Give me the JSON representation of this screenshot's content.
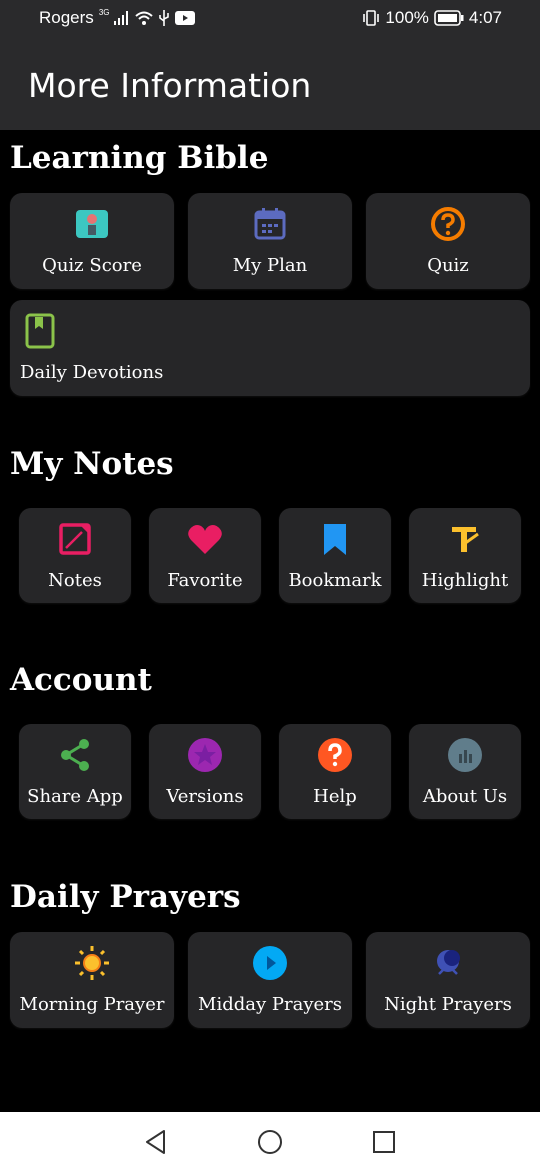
{
  "status": {
    "carrier": "Rogers",
    "network": "3G",
    "battery": "100%",
    "time": "4:07"
  },
  "appbar": {
    "title": "More Information"
  },
  "sections": {
    "learning": {
      "title": "Learning Bible",
      "items": [
        {
          "label": "Quiz Score",
          "icon": "quiz-score-icon"
        },
        {
          "label": "My Plan",
          "icon": "calendar-icon"
        },
        {
          "label": "Quiz",
          "icon": "question-circle-icon"
        },
        {
          "label": "Daily Devotions",
          "icon": "book-icon"
        }
      ]
    },
    "notes": {
      "title": "My Notes",
      "items": [
        {
          "label": "Notes",
          "icon": "note-icon"
        },
        {
          "label": "Favorite",
          "icon": "heart-icon"
        },
        {
          "label": "Bookmark",
          "icon": "bookmark-icon"
        },
        {
          "label": "Highlight",
          "icon": "highlight-icon"
        }
      ]
    },
    "account": {
      "title": "Account",
      "items": [
        {
          "label": "Share App",
          "icon": "share-icon"
        },
        {
          "label": "Versions",
          "icon": "versions-icon"
        },
        {
          "label": "Help",
          "icon": "help-icon"
        },
        {
          "label": "About Us",
          "icon": "info-icon"
        }
      ]
    },
    "prayers": {
      "title": "Daily Prayers",
      "items": [
        {
          "label": "Morning Prayer",
          "icon": "sun-icon"
        },
        {
          "label": "Midday Prayers",
          "icon": "play-circle-icon"
        },
        {
          "label": "Night Prayers",
          "icon": "moon-icon"
        }
      ]
    }
  },
  "colors": {
    "quiz_score": "#3cc7c1",
    "my_plan": "#5c6bc0",
    "quiz": "#f57c00",
    "devotions": "#8bc34a",
    "notes": "#e91e63",
    "favorite": "#e91e63",
    "bookmark": "#2196f3",
    "highlight": "#fbc02d",
    "share": "#4caf50",
    "versions": "#9c27b0",
    "help": "#ff5722",
    "about": "#607d8b",
    "sun": "#fbc02d",
    "midday": "#03a9f4",
    "night": "#3f51b5"
  }
}
